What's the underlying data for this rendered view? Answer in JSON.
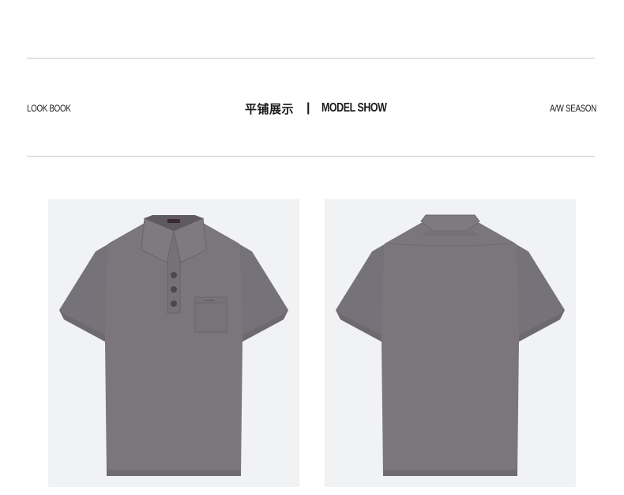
{
  "header": {
    "left_label": "LOOK BOOK",
    "title_cn": "平铺展示",
    "separator": "|",
    "title_en": "MODEL SHOW",
    "right_label": "A/W SEASON"
  },
  "colors": {
    "rule": "#c8c8c8",
    "panel_background": "#f1f2f4",
    "shirt_body": "#7a7679",
    "shirt_shadow": "#6a6669",
    "text": "#1a1a1a"
  },
  "images": [
    {
      "name": "polo-shirt-front-photo",
      "depicts": "gray polo shirt front view with collar, three buttons and chest pocket"
    },
    {
      "name": "polo-shirt-back-photo",
      "depicts": "gray polo shirt back view"
    }
  ]
}
